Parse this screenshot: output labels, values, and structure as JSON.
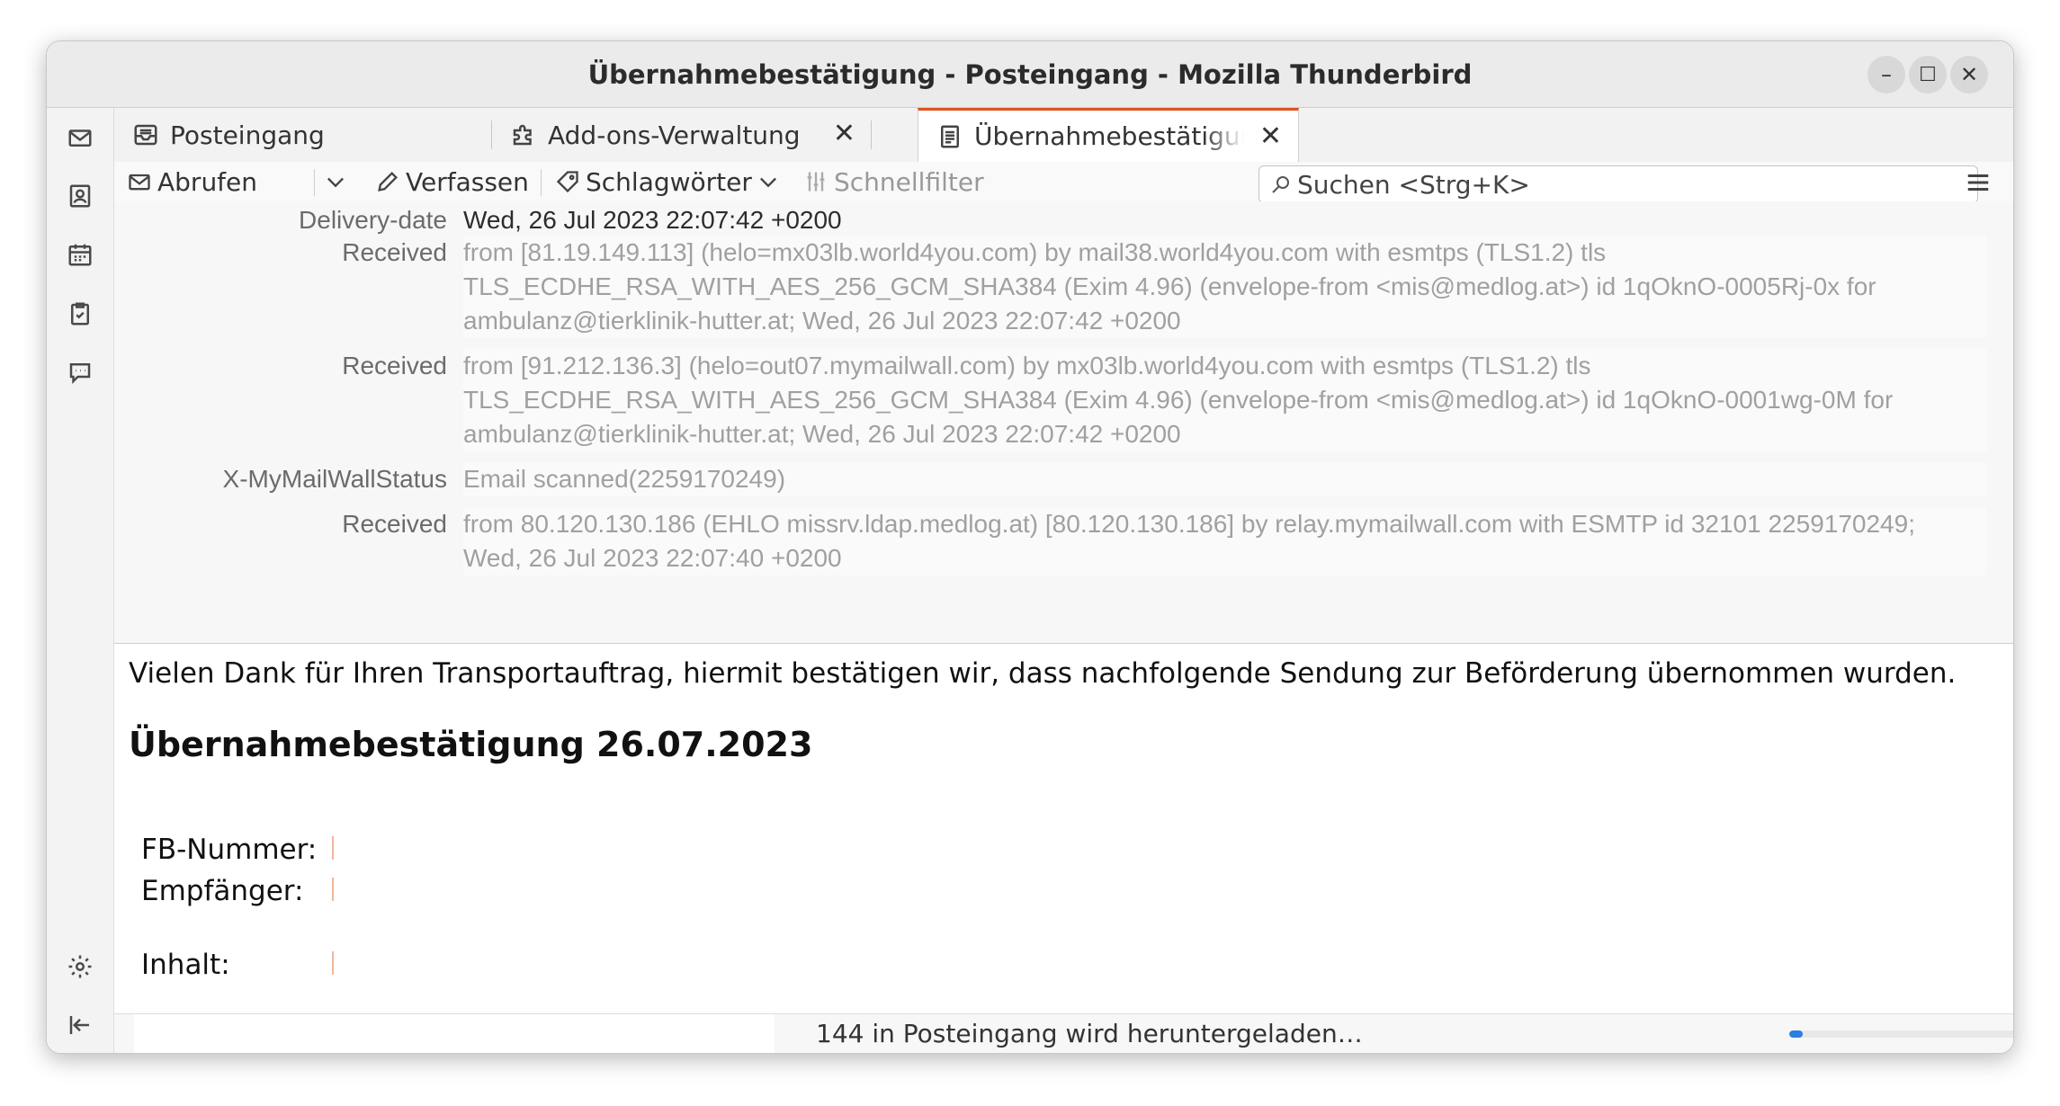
{
  "window": {
    "title": "Übernahmebestätigung - Posteingang - Mozilla Thunderbird",
    "minimize": "–",
    "maximize": "☐",
    "close": "✕"
  },
  "spaces": [
    "mail-icon",
    "address-book-icon",
    "calendar-icon",
    "tasks-icon",
    "chat-icon",
    "settings-icon",
    "collapse-icon"
  ],
  "tabs": [
    {
      "label": "Posteingang",
      "icon": "inbox-icon",
      "closable": false
    },
    {
      "label": "Add-ons-Verwaltung",
      "icon": "puzzle-icon",
      "closable": true
    },
    {
      "label": "Übernahmebestätigung",
      "icon": "message-icon",
      "closable": true,
      "active": true
    }
  ],
  "toolbar": {
    "get_messages": "Abrufen",
    "compose": "Verfassen",
    "tags": "Schlagwörter",
    "quick_filter": "Schnellfilter",
    "search_placeholder": "Suchen <Strg+K>"
  },
  "headers": [
    {
      "name": "Delivery-date",
      "value": "Wed, 26 Jul 2023 22:07:42 +0200"
    },
    {
      "name": "Received",
      "value": "from [81.19.149.113] (helo=mx03lb.world4you.com) by mail38.world4you.com with esmtps (TLS1.2) tls\nTLS_ECDHE_RSA_WITH_AES_256_GCM_SHA384 (Exim 4.96) (envelope-from <mis@medlog.at>) id 1qOknO-0005Rj-0x for\nambulanz@tierklinik-hutter.at; Wed, 26 Jul 2023 22:07:42 +0200"
    },
    {
      "name": "Received",
      "value": "from [91.212.136.3] (helo=out07.mymailwall.com) by mx03lb.world4you.com with esmtps (TLS1.2) tls\nTLS_ECDHE_RSA_WITH_AES_256_GCM_SHA384 (Exim 4.96) (envelope-from <mis@medlog.at>) id 1qOknO-0001wg-0M for\nambulanz@tierklinik-hutter.at; Wed, 26 Jul 2023 22:07:42 +0200"
    },
    {
      "name": "X-MyMailWallStatus",
      "value": "Email scanned(2259170249)"
    },
    {
      "name": "Received",
      "value": "from 80.120.130.186 (EHLO missrv.ldap.medlog.at) [80.120.130.186] by relay.mymailwall.com with ESMTP id 32101 2259170249;\nWed, 26 Jul 2023 22:07:40 +0200"
    }
  ],
  "body": {
    "intro": "Vielen Dank für Ihren Transportauftrag, hiermit bestätigen wir, dass nachfolgende Sendung zur Beförderung übernommen wurden.",
    "heading": "Übernahmebestätigung 26.07.2023",
    "fields": [
      {
        "label": "FB-Nummer:"
      },
      {
        "label": "Empfänger:"
      },
      {
        "label": "Inhalt:"
      }
    ]
  },
  "status": {
    "text": "144 in Posteingang wird heruntergeladen…",
    "progress": 0.05
  }
}
